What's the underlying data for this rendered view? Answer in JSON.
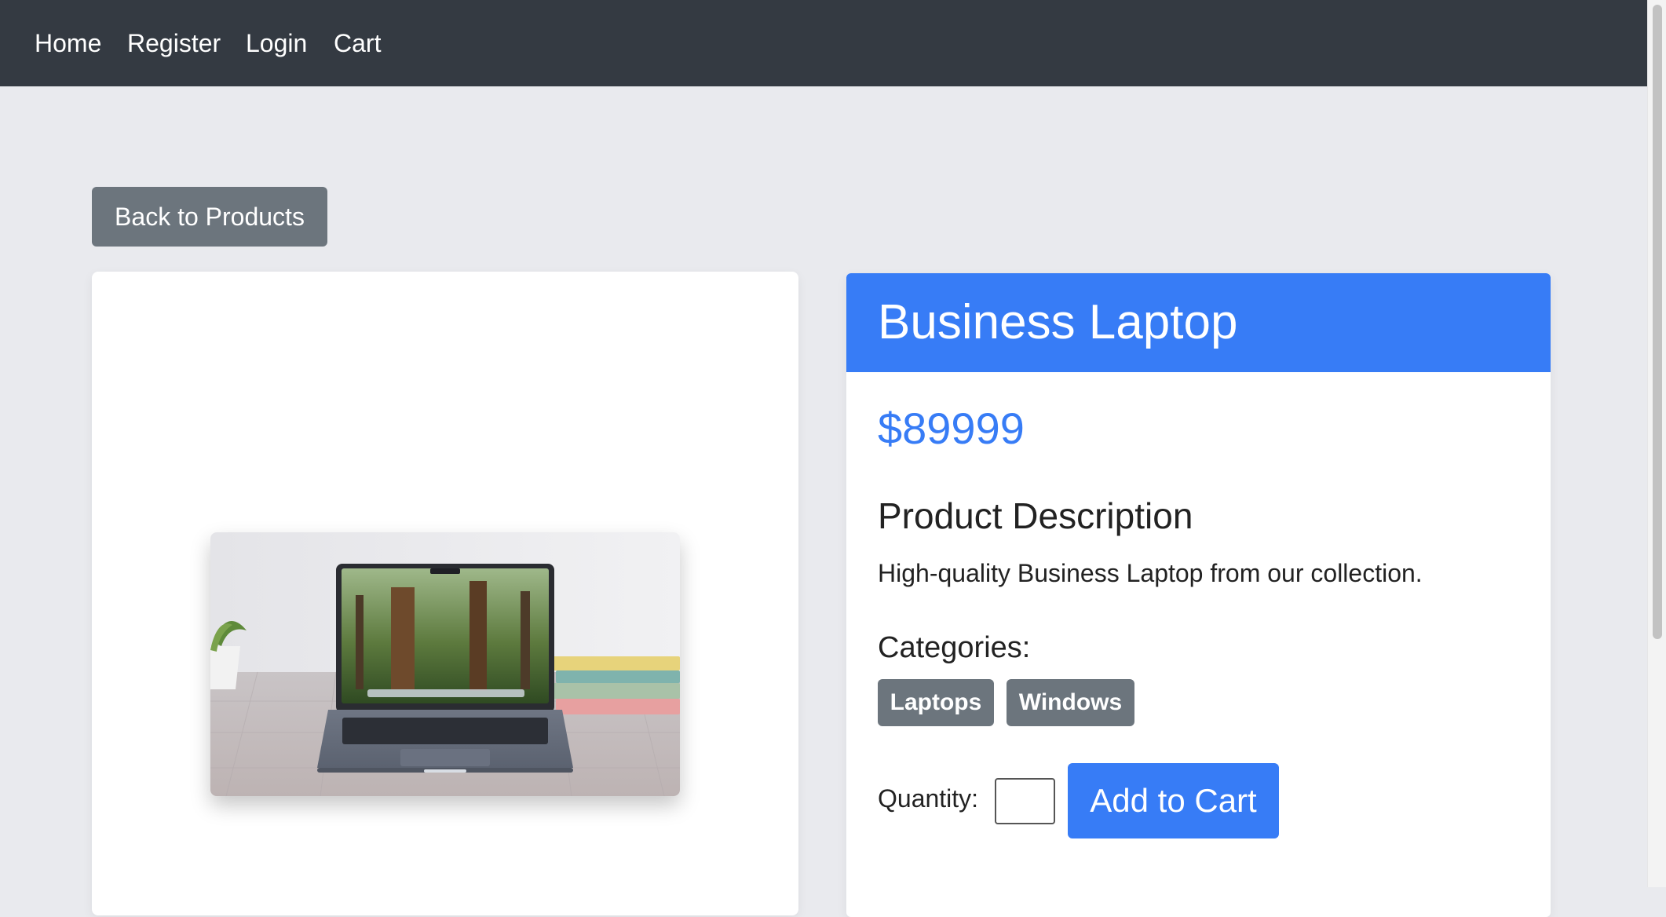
{
  "nav": {
    "links": [
      "Home",
      "Register",
      "Login",
      "Cart"
    ]
  },
  "back_button": "Back to Products",
  "product": {
    "title": "Business Laptop",
    "price": "$89999",
    "description_heading": "Product Description",
    "description": "High-quality Business Laptop from our collection.",
    "categories_heading": "Categories:",
    "categories": [
      "Laptops",
      "Windows"
    ],
    "quantity_label": "Quantity:",
    "quantity_value": "",
    "add_to_cart": "Add to Cart",
    "image_subject": "laptop-photo"
  },
  "colors": {
    "navbar": "#343a42",
    "primary": "#377cf6",
    "secondary": "#6c757d",
    "page_background": "#e9eaee"
  }
}
